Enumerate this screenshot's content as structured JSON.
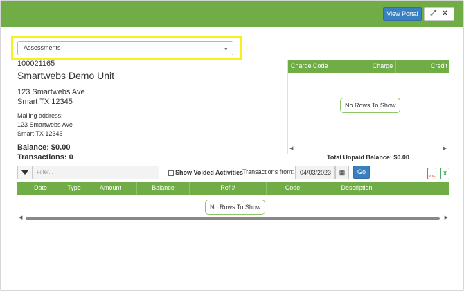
{
  "header": {
    "view_portal_label": "View Portal",
    "expand_icon": "expand-icon",
    "close_icon": "close-icon",
    "accent_color": "#70ad47"
  },
  "selector": {
    "selected": "Assessments",
    "highlight_color": "#f7f01c"
  },
  "unit": {
    "id": "100021165",
    "name": "Smartwebs Demo Unit",
    "address_line1": "123 Smartwebs Ave",
    "address_line2": "Smart TX 12345",
    "mailing_label": "Mailing address:",
    "mailing_line1": "123 Smartwebs Ave",
    "mailing_line2": "Smart TX 12345",
    "balance": "Balance: $0.00",
    "transactions": "Transactions: 0"
  },
  "charges_grid": {
    "columns": [
      "Charge Code",
      "Charge",
      "Credit"
    ],
    "empty_text": "No Rows To Show",
    "total_unpaid": "Total Unpaid Balance: $0.00"
  },
  "toolbar": {
    "filter_placeholder": "Filter...",
    "show_voided_label": "Show Voided Activities",
    "show_voided_checked": false,
    "transactions_from_label": "Transactions from:",
    "date_value": "04/03/2023",
    "go_label": "Go",
    "pdf_icon": "pdf-icon",
    "excel_icon": "excel-icon",
    "pdf_text": "PDF",
    "excel_text": "X"
  },
  "transactions_grid": {
    "columns": [
      "Date",
      "Type",
      "Amount",
      "Balance",
      "Ref #",
      "Code",
      "Description"
    ],
    "empty_text": "No Rows To Show"
  }
}
